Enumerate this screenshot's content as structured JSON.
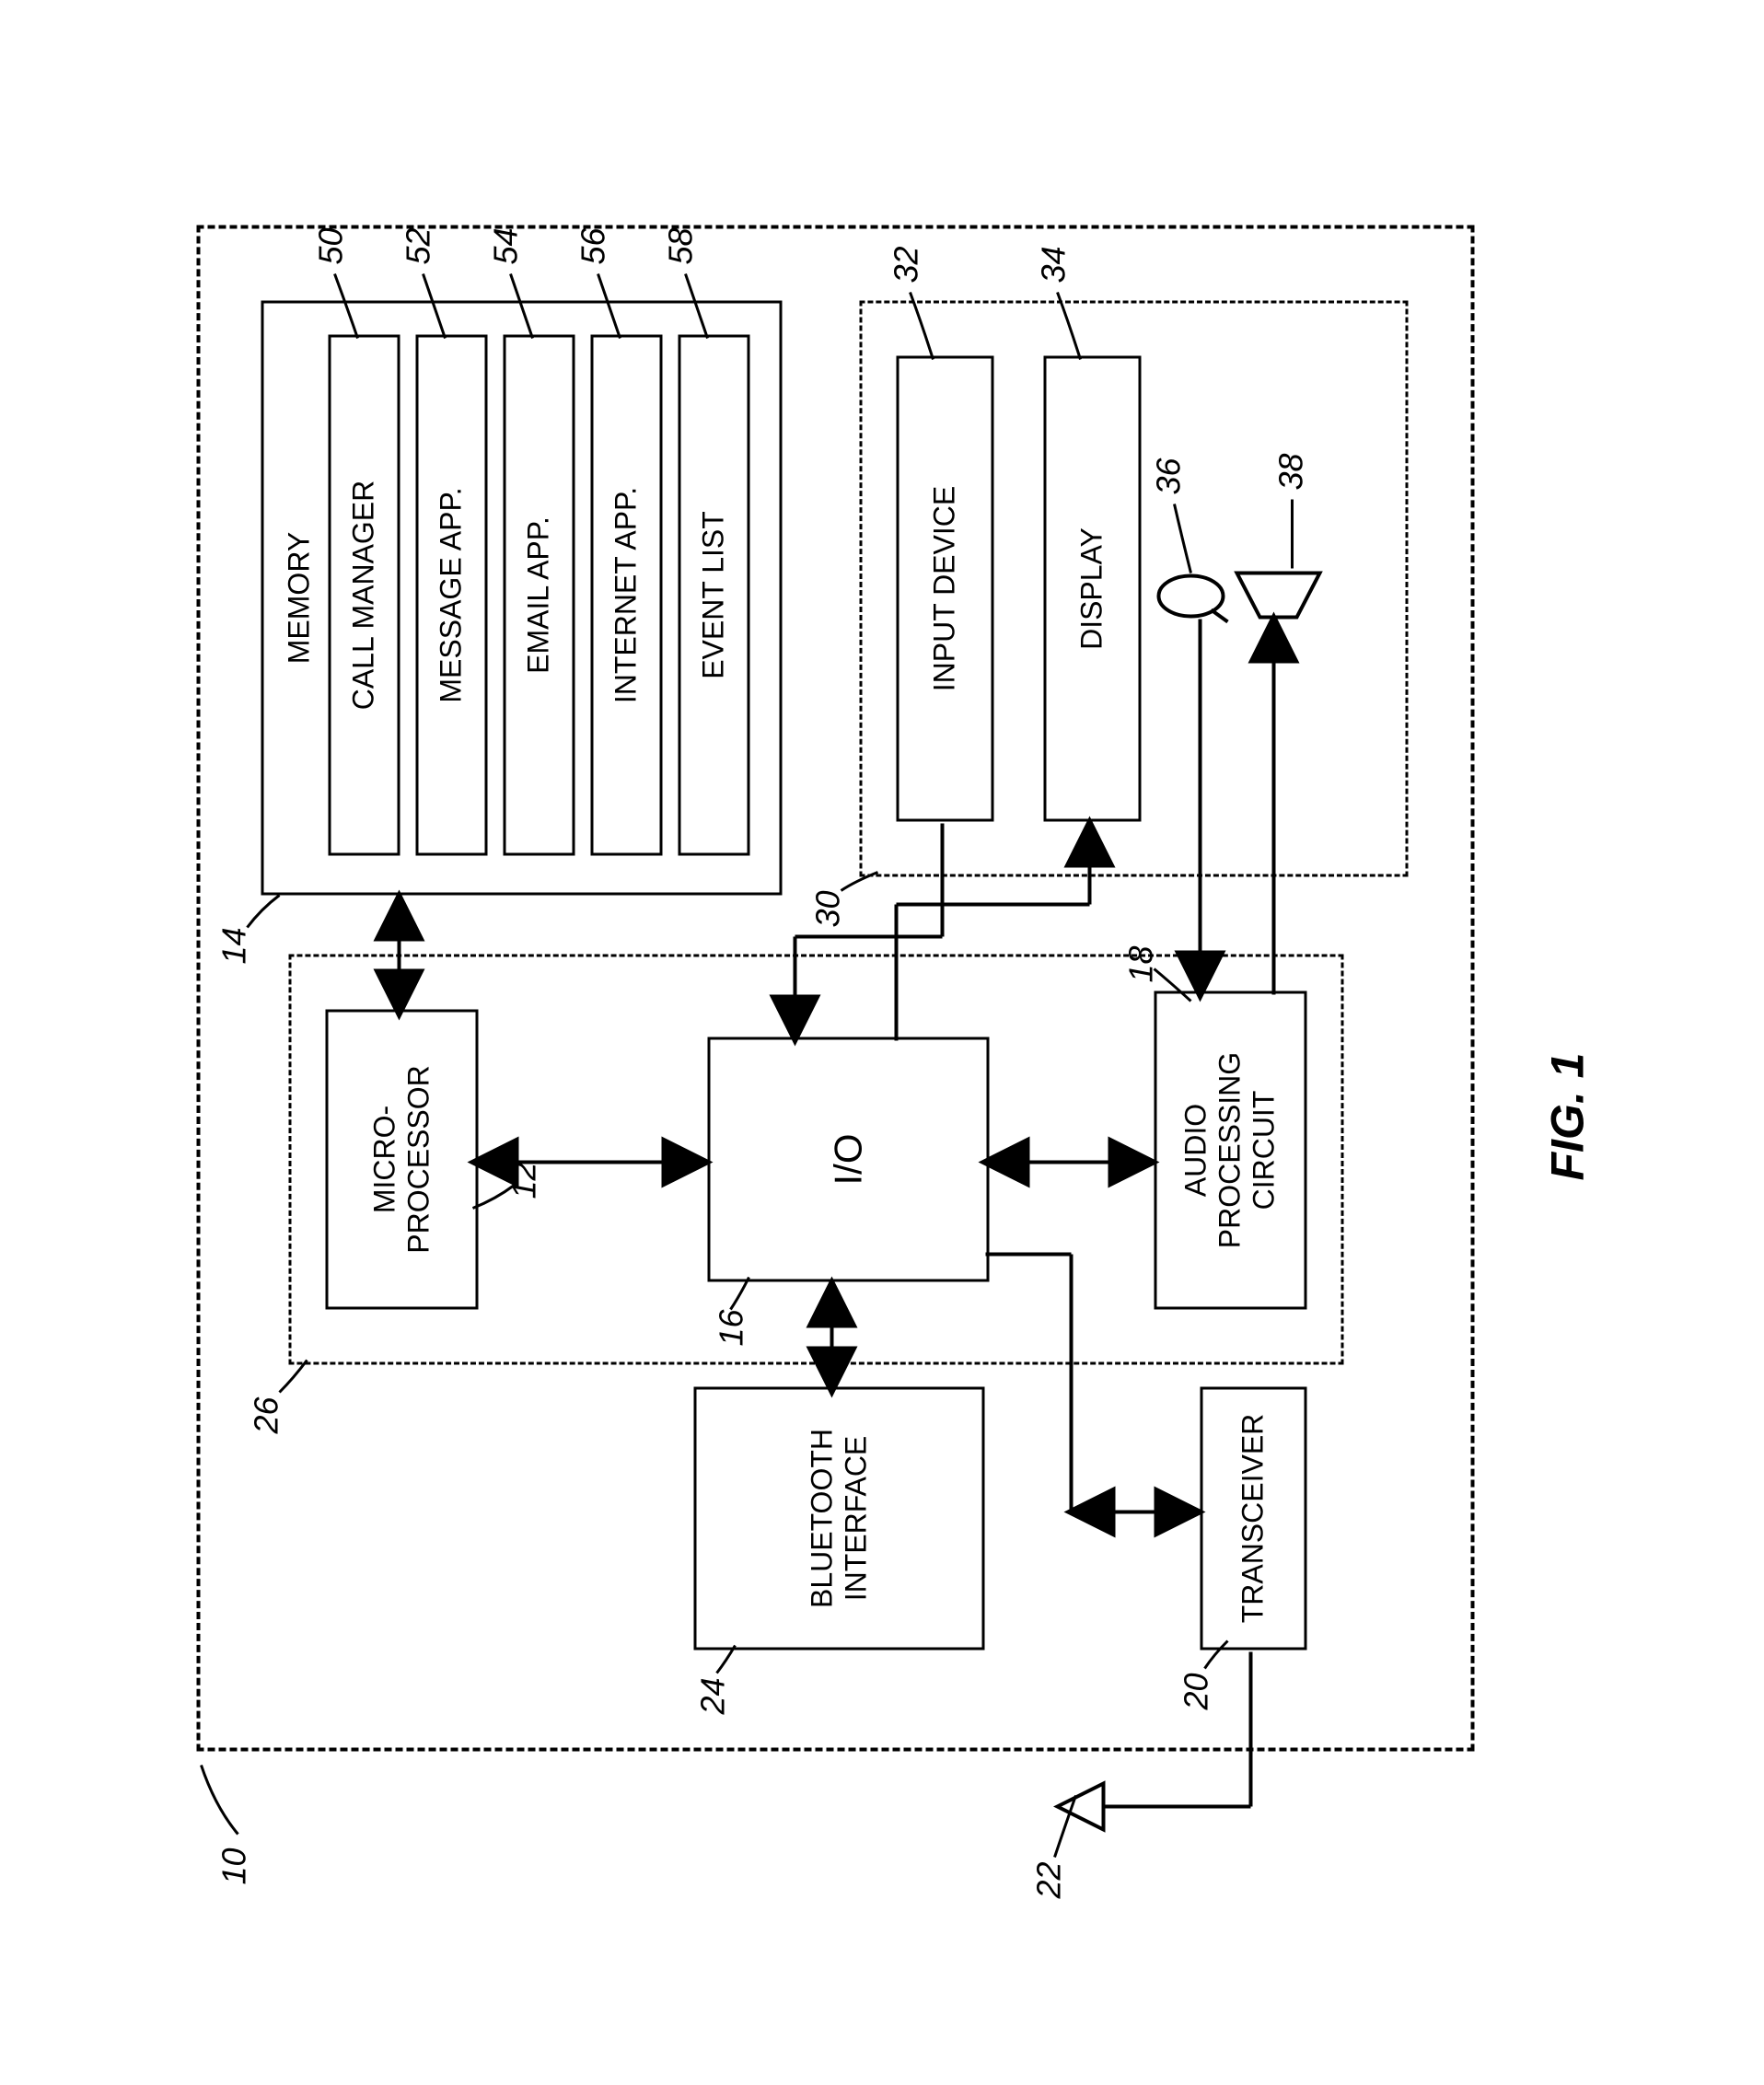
{
  "figure_label": "FIG. 1",
  "outer_ref": "10",
  "memory": {
    "label": "MEMORY",
    "ref": "14",
    "items": [
      {
        "label": "CALL MANAGER",
        "ref": "50"
      },
      {
        "label": "MESSAGE APP.",
        "ref": "52"
      },
      {
        "label": "EMAIL APP.",
        "ref": "54"
      },
      {
        "label": "INTERNET APP.",
        "ref": "56"
      },
      {
        "label": "EVENT LIST",
        "ref": "58"
      }
    ]
  },
  "controller_ref": "26",
  "blocks": {
    "microprocessor": {
      "label": "MICRO-\nPROCESSOR",
      "ref": "12"
    },
    "io": {
      "label": "I/O",
      "ref": "16"
    },
    "audio": {
      "label": "AUDIO\nPROCESSING\nCIRCUIT",
      "ref": "18"
    },
    "bluetooth": {
      "label": "BLUETOOTH\nINTERFACE",
      "ref": "24"
    },
    "transceiver": {
      "label": "TRANSCEIVER",
      "ref": "20"
    },
    "antenna_ref": "22",
    "input_device": {
      "label": "INPUT DEVICE",
      "ref": "32"
    },
    "display": {
      "label": "DISPLAY",
      "ref": "34"
    },
    "mic_ref": "36",
    "speaker_ref": "38"
  },
  "ui_ref": "30"
}
